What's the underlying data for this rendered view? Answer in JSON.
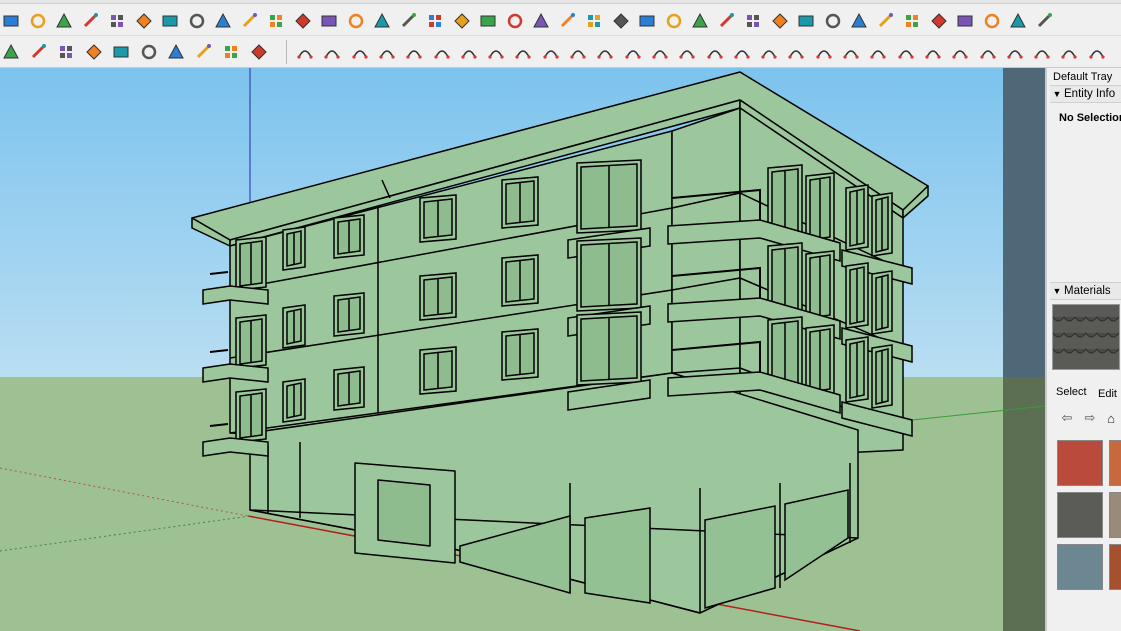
{
  "toolbar": {
    "row1_icons": [
      "paint-bucket-icon",
      "eraser-icon",
      "tape-icon",
      "push-pull-icon",
      "follow-me-icon",
      "offset-icon",
      "box-icon",
      "table-icon",
      "flag-icon",
      "link-icon",
      "line-icon",
      "arc-icon",
      "freehand-icon",
      "plus-red-icon",
      "plus-green-icon",
      "cross-icon",
      "move-icon",
      "scale-icon",
      "warning-icon",
      "rotate-icon",
      "flip-icon",
      "sync-icon",
      "cube-icon",
      "undo-red-icon",
      "group-icon",
      "component-icon",
      "solid-tools-icon",
      "union-icon",
      "subtract-icon",
      "trim-icon",
      "split-icon",
      "grid-icon",
      "section-icon",
      "orange-grid-icon",
      "scatter-icon",
      "circle-dashed-icon",
      "camera-icon",
      "view-front-icon",
      "view-back-icon",
      "view-left-icon"
    ],
    "row2_left_icons": [
      "refresh-icon",
      "layers-icon",
      "add-circle-icon",
      "tree-icon",
      "sun-icon",
      "checker-icon",
      "cloud-upload-icon",
      "gear-icon",
      "mail-icon",
      "info-icon"
    ],
    "row2_right_icons": [
      "bezier-icon",
      "curve-icon",
      "spray-icon",
      "arrow-diag-icon",
      "lasso-icon",
      "shape-icon",
      "curl-icon",
      "loft-icon",
      "globe-icon",
      "arc-tool-icon",
      "angle-icon",
      "angle-red-icon",
      "slope-icon",
      "bend-icon",
      "house-icon",
      "stairs-icon",
      "columns-icon",
      "fence-icon",
      "globe-grid-icon",
      "leaf-icon",
      "wall-icon",
      "roof-icon",
      "ramp-icon",
      "fan-icon",
      "stairs2-icon",
      "railing-icon",
      "bar-icon",
      "pen-icon",
      "shelf-icon",
      "tile-icon"
    ]
  },
  "tray": {
    "title": "Default Tray",
    "entity_info": {
      "heading": "Entity Info",
      "status": "No Selection"
    },
    "materials": {
      "heading": "Materials",
      "tabs": [
        "Select",
        "Edit"
      ],
      "nav_icons": [
        "back-arrow-icon",
        "forward-arrow-icon",
        "home-icon"
      ],
      "swatches": [
        {
          "name": "roof-tiles-red",
          "color": "#b94a3c"
        },
        {
          "name": "roof-tiles-orange",
          "color": "#c7693f"
        },
        {
          "name": "roof-shingles-dark",
          "color": "#5b5b58"
        },
        {
          "name": "roof-shingles-tan",
          "color": "#9a8a7a"
        },
        {
          "name": "stone-blue-gray",
          "color": "#6c8791"
        },
        {
          "name": "stone-rust",
          "color": "#a5512f"
        }
      ]
    }
  },
  "viewport": {
    "sky_color": "#7fc7ee",
    "ground_color": "#9dc193",
    "model_color": "#9cc79c",
    "edge_color": "#000000"
  }
}
